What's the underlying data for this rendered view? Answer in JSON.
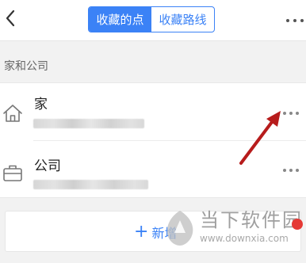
{
  "header": {
    "tabs": [
      {
        "label": "收藏的点",
        "active": true
      },
      {
        "label": "收藏路线",
        "active": false
      }
    ]
  },
  "section": {
    "label": "家和公司"
  },
  "list": {
    "items": [
      {
        "title": "家",
        "icon": "home-icon"
      },
      {
        "title": "公司",
        "icon": "briefcase-icon"
      }
    ]
  },
  "add": {
    "plus": "+",
    "label": "新增"
  },
  "watermark": {
    "name": "当下软件园",
    "url": "www.downxia.com"
  },
  "colors": {
    "accent": "#3b82f6",
    "arrow": "#b71c1c",
    "background": "#f2f2f2"
  }
}
